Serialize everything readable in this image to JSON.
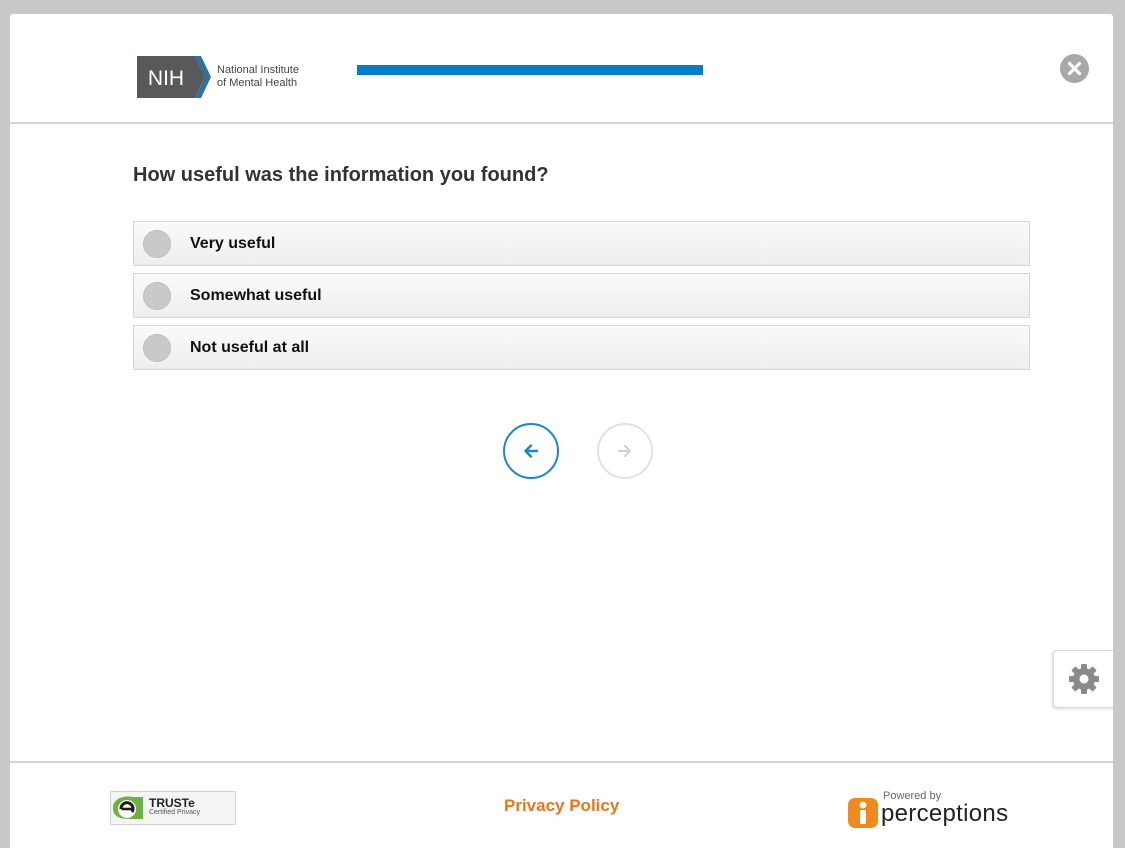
{
  "header": {
    "logo_mark": "NIH",
    "logo_line1": "National Institute",
    "logo_line2": "of Mental Health",
    "progress_fraction": 0.83,
    "close_icon": "close-icon"
  },
  "question": {
    "text": "How useful was the information you found?",
    "options": [
      {
        "label": "Very useful",
        "selected": false
      },
      {
        "label": "Somewhat useful",
        "selected": false
      },
      {
        "label": "Not useful at all",
        "selected": false
      }
    ]
  },
  "navigation": {
    "back_icon": "arrow-left-icon",
    "next_icon": "arrow-right-icon",
    "next_enabled": false
  },
  "settings_icon": "gear-icon",
  "footer": {
    "truste_brand": "TRUSTe",
    "truste_sub": "Certified Privacy",
    "privacy_label": "Privacy Policy",
    "powered_by": "Powered by",
    "perceptions_brand": "perceptions"
  },
  "colors": {
    "accent": "#0a7cc4",
    "link": "#e7761c",
    "radio": "#c9c9c9",
    "disabled": "#e2e2e2"
  }
}
